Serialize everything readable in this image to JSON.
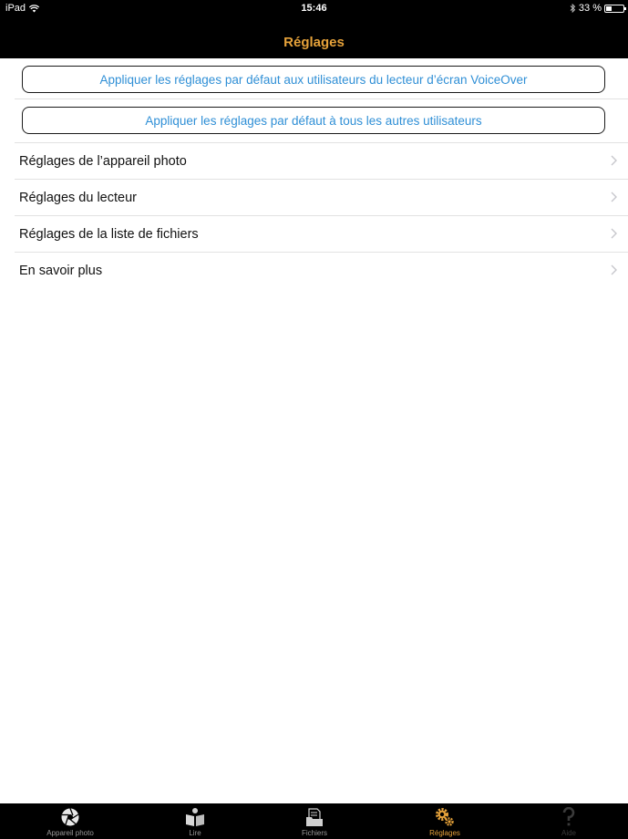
{
  "status_bar": {
    "device": "iPad",
    "time": "15:46",
    "battery_text": "33 %",
    "battery_level": 0.33
  },
  "nav": {
    "title": "Réglages"
  },
  "actions": {
    "voiceover_defaults": "Appliquer les réglages par défaut aux utilisateurs du lecteur d’écran VoiceOver",
    "other_defaults": "Appliquer les réglages par défaut à tous les autres utilisateurs"
  },
  "settings_rows": [
    {
      "label": "Réglages de l’appareil photo"
    },
    {
      "label": "Réglages du lecteur"
    },
    {
      "label": "Réglages de la liste de fichiers"
    },
    {
      "label": "En savoir plus"
    }
  ],
  "tab_bar": {
    "tabs": [
      {
        "label": "Appareil photo",
        "icon": "camera-aperture-icon"
      },
      {
        "label": "Lire",
        "icon": "reader-icon"
      },
      {
        "label": "Fichiers",
        "icon": "folder-icon"
      },
      {
        "label": "Réglages",
        "icon": "gears-icon",
        "active": true
      },
      {
        "label": "Aide",
        "icon": "help-icon"
      }
    ]
  },
  "colors": {
    "accent": "#e6a23a",
    "link_blue": "#2f8fd6",
    "bar_black": "#000000"
  }
}
